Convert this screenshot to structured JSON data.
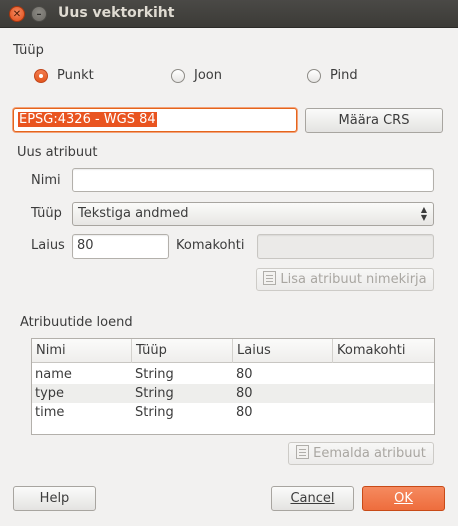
{
  "window": {
    "title": "Uus vektorkiht"
  },
  "type_section": {
    "label": "Tüüp",
    "options": [
      {
        "label": "Punkt",
        "checked": true
      },
      {
        "label": "Joon",
        "checked": false
      },
      {
        "label": "Pind",
        "checked": false
      }
    ]
  },
  "crs": {
    "value": "EPSG:4326 - WGS 84",
    "button_label": "Määra CRS"
  },
  "new_attribute": {
    "heading": "Uus atribuut",
    "name_label": "Nimi",
    "name_value": "",
    "type_label": "Tüüp",
    "type_value": "Tekstiga andmed",
    "width_label": "Laius",
    "width_value": "80",
    "precision_label": "Komakohti",
    "precision_value": "",
    "add_button_label": "Lisa atribuut nimekirja"
  },
  "attribute_list": {
    "heading": "Atribuutide loend",
    "columns": [
      "Nimi",
      "Tüüp",
      "Laius",
      "Komakohti"
    ],
    "rows": [
      [
        "name",
        "String",
        "80",
        ""
      ],
      [
        "type",
        "String",
        "80",
        ""
      ],
      [
        "time",
        "String",
        "80",
        ""
      ]
    ],
    "remove_button_label": "Eemalda atribuut"
  },
  "footer": {
    "help_label": "Help",
    "cancel_label": "Cancel",
    "ok_label": "OK"
  },
  "colors": {
    "accent": "#e95420",
    "titlebar": "#3c3b37"
  }
}
